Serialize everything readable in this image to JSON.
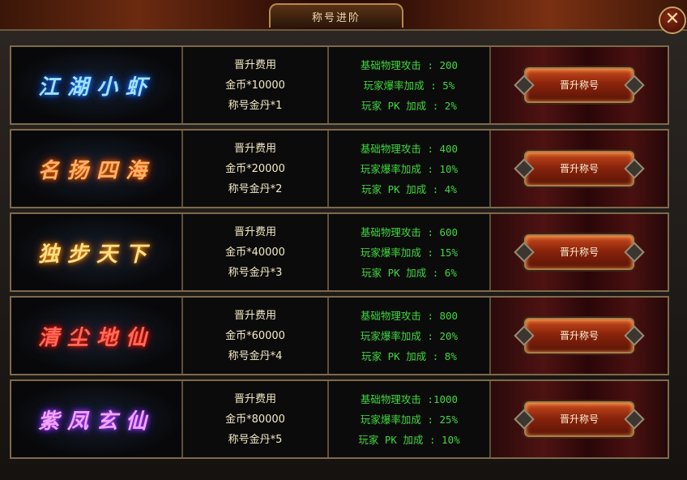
{
  "window": {
    "title": "称号进阶",
    "close_glyph": "✕"
  },
  "rows": [
    {
      "title": "江湖小虾",
      "cost_header": "晋升费用",
      "gold": "金币*10000",
      "pill": "称号金丹*1",
      "attack": "基础物理攻击 : 200",
      "crit": "玩家爆率加成 : 5%",
      "pk": "玩家 PK 加成 : 2%",
      "button": "晋升称号"
    },
    {
      "title": "名扬四海",
      "cost_header": "晋升费用",
      "gold": "金币*20000",
      "pill": "称号金丹*2",
      "attack": "基础物理攻击 : 400",
      "crit": "玩家爆率加成 : 10%",
      "pk": "玩家 PK 加成 : 4%",
      "button": "晋升称号"
    },
    {
      "title": "独步天下",
      "cost_header": "晋升费用",
      "gold": "金币*40000",
      "pill": "称号金丹*3",
      "attack": "基础物理攻击 : 600",
      "crit": "玩家爆率加成 : 15%",
      "pk": "玩家 PK 加成 : 6%",
      "button": "晋升称号"
    },
    {
      "title": "清尘地仙",
      "cost_header": "晋升费用",
      "gold": "金币*60000",
      "pill": "称号金丹*4",
      "attack": "基础物理攻击 : 800",
      "crit": "玩家爆率加成 : 20%",
      "pk": "玩家 PK 加成 : 8%",
      "button": "晋升称号"
    },
    {
      "title": "紫凤玄仙",
      "cost_header": "晋升费用",
      "gold": "金币*80000",
      "pill": "称号金丹*5",
      "attack": "基础物理攻击 :1000",
      "crit": "玩家爆率加成 : 25%",
      "pk": "玩家 PK 加成 : 10%",
      "button": "晋升称号"
    }
  ]
}
